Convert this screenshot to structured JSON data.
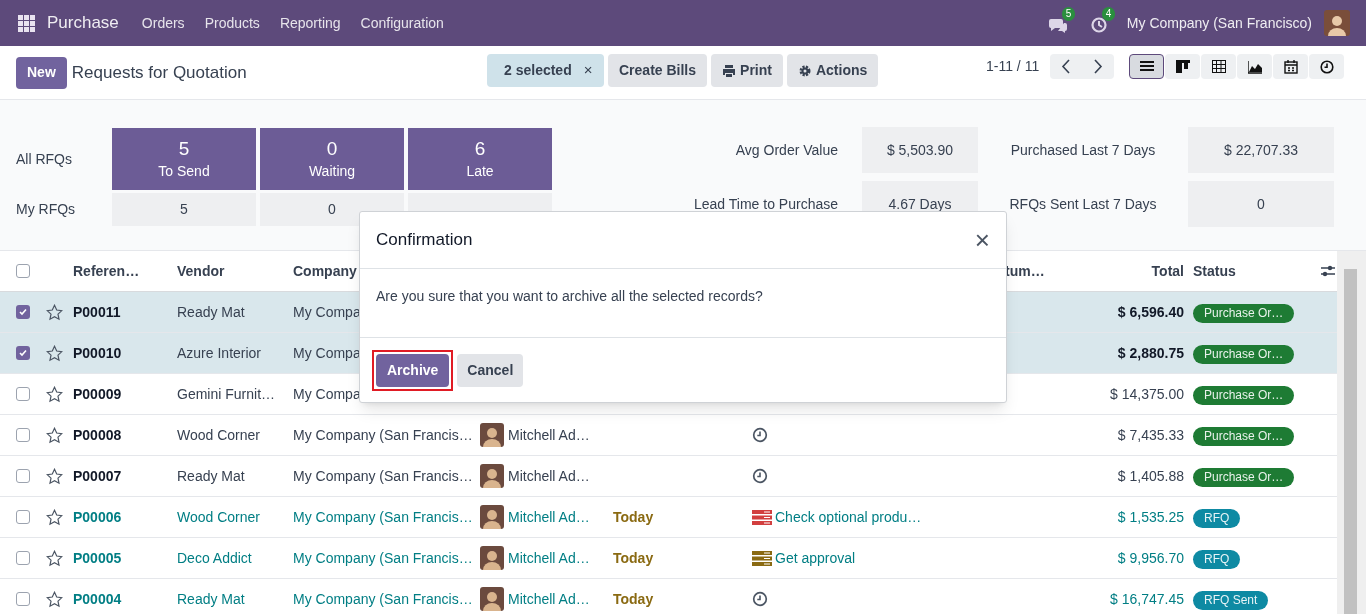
{
  "navbar": {
    "app": "Purchase",
    "menu": [
      "Orders",
      "Products",
      "Reporting",
      "Configuration"
    ],
    "messages_count": "5",
    "activities_count": "4",
    "company": "My Company (San Francisco)"
  },
  "control_panel": {
    "new_button": "New",
    "title": "Requests for Quotation",
    "selection": "2 selected",
    "clear": "×",
    "actions": [
      {
        "kind": "plain",
        "label": "Create Bills"
      },
      {
        "kind": "print",
        "label": "Print"
      },
      {
        "kind": "gear",
        "label": "Actions"
      }
    ],
    "pager": "1-11 / 11",
    "views": [
      {
        "kind": "list",
        "selected": true
      },
      {
        "kind": "kanban",
        "selected": false
      },
      {
        "kind": "pivot",
        "selected": false
      },
      {
        "kind": "graph",
        "selected": false
      },
      {
        "kind": "calendar",
        "selected": false
      },
      {
        "kind": "activity",
        "selected": false
      }
    ]
  },
  "dashboard": {
    "row_labels": [
      "All RFQs",
      "My RFQs"
    ],
    "tiles": [
      {
        "value": "5",
        "label": "To Send",
        "mine": "5"
      },
      {
        "value": "0",
        "label": "Waiting",
        "mine": "0"
      },
      {
        "value": "6",
        "label": "Late"
      }
    ],
    "stats": [
      [
        {
          "label": "Avg Order Value",
          "value": "$ 5,503.90"
        },
        {
          "label": "Purchased Last 7 Days",
          "value": "$ 22,707.33"
        }
      ],
      [
        {
          "label": "Lead Time to Purchase",
          "value": "4.67 Days"
        },
        {
          "label": "RFQs Sent Last 7 Days",
          "value": "0"
        }
      ]
    ]
  },
  "table": {
    "all_selected": false,
    "columns": [
      "Referen…",
      "Vendor",
      "Company",
      "tum…",
      "Total",
      "Status"
    ],
    "rows": [
      {
        "selected": true,
        "highlighted": false,
        "ref": "P00011",
        "vendor": "Ready Mat",
        "company": "My Compa",
        "total": "$ 6,596.40",
        "status": {
          "label": "Purchase Or…",
          "color": "#1e7b34"
        }
      },
      {
        "selected": true,
        "highlighted": false,
        "ref": "P00010",
        "vendor": "Azure Interior",
        "company": "My Compa",
        "total": "$ 2,880.75",
        "status": {
          "label": "Purchase Or…",
          "color": "#1e7b34"
        }
      },
      {
        "selected": false,
        "highlighted": false,
        "ref": "P00009",
        "vendor": "Gemini Furnit…",
        "company": "My Compa",
        "total": "$ 14,375.00",
        "status": {
          "label": "Purchase Or…",
          "color": "#1e7b34"
        }
      },
      {
        "selected": false,
        "highlighted": false,
        "ref": "P00008",
        "vendor": "Wood Corner",
        "company": "My Company (San Francis…",
        "buyer": "Mitchell Ad…",
        "activity": {
          "kind": "clock"
        },
        "total": "$ 7,435.33",
        "status": {
          "label": "Purchase Or…",
          "color": "#1e7b34"
        }
      },
      {
        "selected": false,
        "highlighted": false,
        "ref": "P00007",
        "vendor": "Ready Mat",
        "company": "My Company (San Francis…",
        "buyer": "Mitchell Ad…",
        "activity": {
          "kind": "clock"
        },
        "total": "$ 1,405.88",
        "status": {
          "label": "Purchase Or…",
          "color": "#1e7b34"
        }
      },
      {
        "selected": false,
        "highlighted": true,
        "ref": "P00006",
        "vendor": "Wood Corner",
        "company": "My Company (San Francis…",
        "buyer": "Mitchell Ad…",
        "deadline": "Today",
        "activity": {
          "kind": "task",
          "color": "#d23f3f",
          "text": "Check optional produ…"
        },
        "total": "$ 1,535.25",
        "status": {
          "label": "RFQ",
          "color": "#0e8aa3"
        }
      },
      {
        "selected": false,
        "highlighted": true,
        "ref": "P00005",
        "vendor": "Deco Addict",
        "company": "My Company (San Francis…",
        "buyer": "Mitchell Ad…",
        "deadline": "Today",
        "activity": {
          "kind": "task",
          "color": "#8a6a12",
          "text": "Get approval"
        },
        "total": "$ 9,956.70",
        "status": {
          "label": "RFQ",
          "color": "#0e8aa3"
        }
      },
      {
        "selected": false,
        "highlighted": true,
        "ref": "P00004",
        "vendor": "Ready Mat",
        "company": "My Company (San Francis…",
        "buyer": "Mitchell Ad…",
        "deadline": "Today",
        "activity": {
          "kind": "clock"
        },
        "total": "$ 16,747.45",
        "status": {
          "label": "RFQ Sent",
          "color": "#0e8aa3"
        }
      }
    ]
  },
  "dialog": {
    "title": "Confirmation",
    "close": "×",
    "message": "Are you sure that you want to archive all the selected records?",
    "confirm": "Archive",
    "cancel": "Cancel",
    "confirm_highlighted": true
  }
}
